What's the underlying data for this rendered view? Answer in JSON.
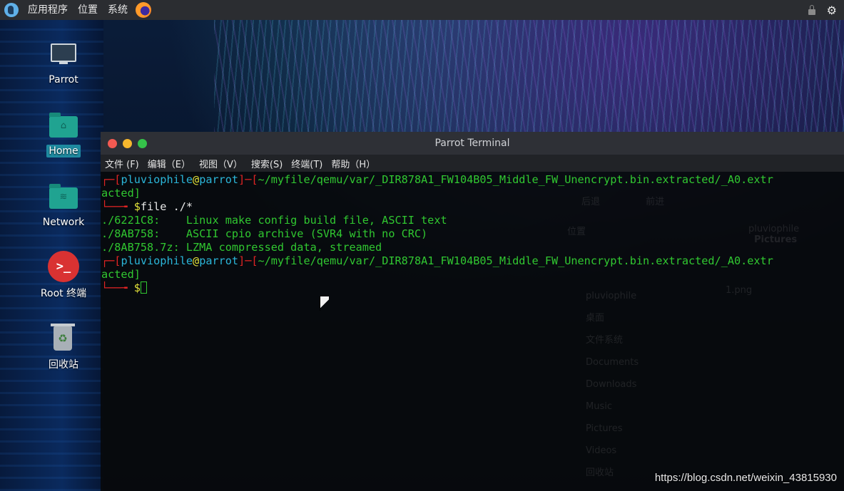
{
  "top_panel": {
    "menus": [
      "应用程序",
      "位置",
      "系统"
    ]
  },
  "desktop": {
    "icons": [
      {
        "label": "Parrot",
        "icon": "monitor-icon"
      },
      {
        "label": "Home",
        "icon": "home-folder-icon",
        "selected": true
      },
      {
        "label": "Network",
        "icon": "network-folder-icon"
      },
      {
        "label": "Root 终端",
        "icon": "root-terminal-icon"
      },
      {
        "label": "回收站",
        "icon": "trash-icon"
      }
    ]
  },
  "terminal": {
    "title": "Parrot Terminal",
    "menus": [
      "文件 (F)",
      "编辑（E）",
      "视图（V）",
      "搜索(S)",
      "终端(T)",
      "帮助（H）"
    ],
    "user": "pluviophile",
    "at": "@",
    "host": "parrot",
    "path_line": "~/myfile/qemu/var/_DIR878A1_FW104B05_Middle_FW_Unencrypt.bin.extracted/_A0.extr",
    "path_wrap": "acted]",
    "prompt_prefix": "┌─[",
    "prompt_sep": "]─[",
    "prompt_cmd_prefix": "└──╼ ",
    "command": "file ./*",
    "output": [
      "./6221C8:    Linux make config build file, ASCII text",
      "./8AB758:    ASCII cpio archive (SVR4 with no CRC)",
      "./8AB758.7z: LZMA compressed data, streamed"
    ],
    "dollar": "$"
  },
  "background_file_manager": {
    "toolbar": [
      "后退",
      "前进"
    ],
    "location_label": "位置",
    "breadcrumb": [
      "pluviophile",
      "Pictures"
    ],
    "sidebar": [
      "pluviophile",
      "桌面",
      "文件系统",
      "Documents",
      "Downloads",
      "Music",
      "Pictures",
      "Videos",
      "回收站"
    ],
    "file": "1.png"
  },
  "watermark": "https://blog.csdn.net/weixin_43815930"
}
